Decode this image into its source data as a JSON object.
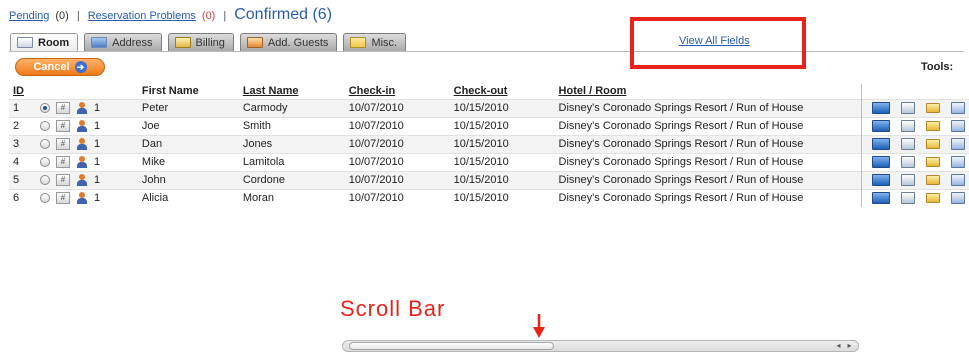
{
  "nav": {
    "pending_label": "Pending",
    "pending_count": "(0)",
    "problems_label": "Reservation Problems",
    "problems_count": "(0)",
    "separator": "|",
    "current_label": "Confirmed (6)"
  },
  "tabs": [
    {
      "label": "Room",
      "icon": "room-icon",
      "active": true
    },
    {
      "label": "Address",
      "icon": "address-icon",
      "active": false
    },
    {
      "label": "Billing",
      "icon": "billing-icon",
      "active": false
    },
    {
      "label": "Add. Guests",
      "icon": "guests-icon",
      "active": false
    },
    {
      "label": "Misc.",
      "icon": "misc-icon",
      "active": false
    }
  ],
  "view_all_label": "View All Fields",
  "toolbar": {
    "cancel_label": "Cancel",
    "tools_label": "Tools:"
  },
  "table": {
    "columns": [
      "ID",
      "",
      "First Name",
      "Last Name",
      "Check-in",
      "Check-out",
      "Hotel / Room",
      ""
    ],
    "rows": [
      {
        "id": "1",
        "guests": "1",
        "first": "Peter",
        "last": "Carmody",
        "checkin": "10/07/2010",
        "checkout": "10/15/2010",
        "hotel": "Disney's Coronado Springs Resort / Run of House",
        "selected": true
      },
      {
        "id": "2",
        "guests": "1",
        "first": "Joe",
        "last": "Smith",
        "checkin": "10/07/2010",
        "checkout": "10/15/2010",
        "hotel": "Disney's Coronado Springs Resort / Run of House",
        "selected": false
      },
      {
        "id": "3",
        "guests": "1",
        "first": "Dan",
        "last": "Jones",
        "checkin": "10/07/2010",
        "checkout": "10/15/2010",
        "hotel": "Disney's Coronado Springs Resort / Run of House",
        "selected": false
      },
      {
        "id": "4",
        "guests": "1",
        "first": "Mike",
        "last": "Lamitola",
        "checkin": "10/07/2010",
        "checkout": "10/15/2010",
        "hotel": "Disney's Coronado Springs Resort / Run of House",
        "selected": false
      },
      {
        "id": "5",
        "guests": "1",
        "first": "John",
        "last": "Cordone",
        "checkin": "10/07/2010",
        "checkout": "10/15/2010",
        "hotel": "Disney's Coronado Springs Resort / Run of House",
        "selected": false
      },
      {
        "id": "6",
        "guests": "1",
        "first": "Alicia",
        "last": "Moran",
        "checkin": "10/07/2010",
        "checkout": "10/15/2010",
        "hotel": "Disney's Coronado Springs Resort / Run of House",
        "selected": false
      }
    ],
    "row_tools": [
      "screen-icon",
      "print-icon",
      "folder-icon",
      "edit-icon"
    ]
  },
  "annotation": {
    "label": "Scroll Bar",
    "color": "#e8231c"
  },
  "colors": {
    "link": "#2a5db0",
    "accent": "#ee7a1a",
    "annotation": "#e8231c"
  }
}
